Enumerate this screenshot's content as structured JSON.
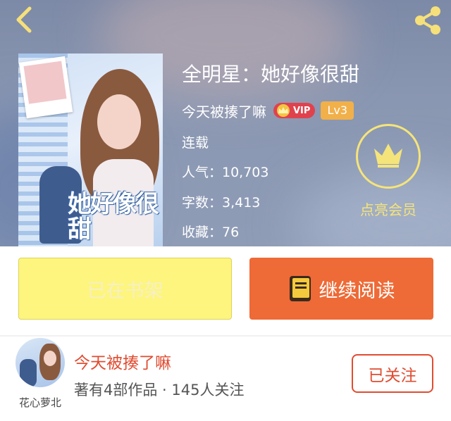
{
  "nav": {
    "back_icon": "chevron-left-icon",
    "share_icon": "share-icon",
    "icon_color": "#f6e07a"
  },
  "cover": {
    "title_text": "她好像很甜"
  },
  "book": {
    "title": "全明星：她好像很甜",
    "author": "今天被揍了嘛",
    "vip_label": "VIP",
    "level": "Lv3",
    "status": "连载",
    "popularity": "人气：10,703",
    "word_count": "字数：3,413",
    "favorites": "收藏：76"
  },
  "member": {
    "label": "点亮会员",
    "icon": "crown-icon",
    "color": "#f5e47a"
  },
  "actions": {
    "shelf_label": "已在书架",
    "read_label": "继续阅读",
    "read_icon": "book-icon",
    "shelf_color": "#fdf57e",
    "read_color": "#ee6a36"
  },
  "author_section": {
    "avatar_tag": "花心萝北",
    "name": "今天被揍了嘛",
    "meta": "著有4部作品 · 145人关注",
    "follow_label": "已关注",
    "accent_color": "#e04c31"
  }
}
